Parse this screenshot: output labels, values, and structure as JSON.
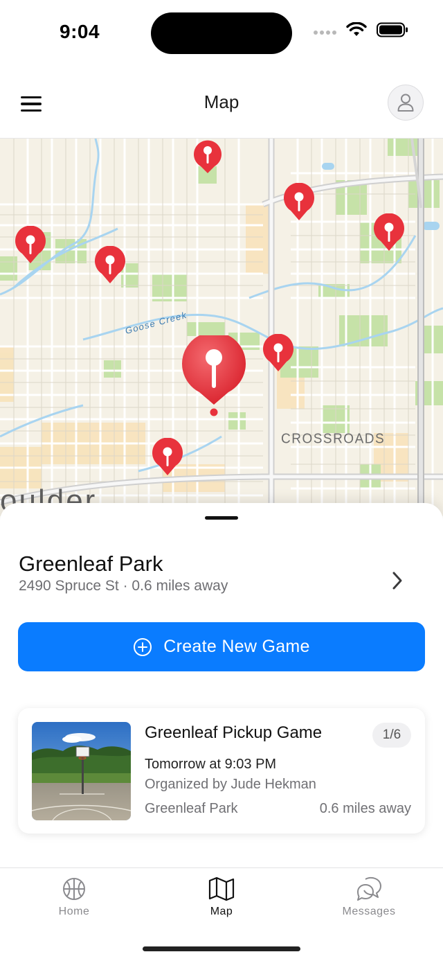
{
  "status_bar": {
    "time": "9:04"
  },
  "nav": {
    "title": "Map"
  },
  "map": {
    "labels": {
      "area": "CROSSROADS",
      "creek": "Goose Creek",
      "city": "oulder"
    },
    "pin_color": "#e8323c"
  },
  "place": {
    "name": "Greenleaf Park",
    "subtitle": "2490 Spruce St · 0.6 miles away"
  },
  "actions": {
    "create_game": "Create New Game"
  },
  "game": {
    "title": "Greenleaf Pickup Game",
    "count": "1/6",
    "time": "Tomorrow at 9:03 PM",
    "organizer": "Organized by Jude Hekman",
    "location": "Greenleaf Park",
    "distance": "0.6 miles away"
  },
  "tabs": [
    {
      "label": "Home",
      "icon": "basketball-icon"
    },
    {
      "label": "Map",
      "icon": "map-icon",
      "active": true
    },
    {
      "label": "Messages",
      "icon": "chat-bubbles-icon"
    }
  ],
  "colors": {
    "accent": "#0a7cff",
    "pin": "#e8323c",
    "park": "#c6e2a8",
    "water": "#a8d4f0"
  }
}
